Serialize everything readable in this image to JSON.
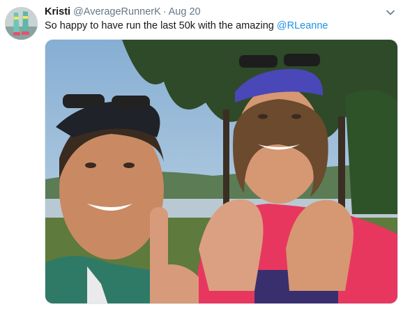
{
  "tweet": {
    "display_name": "Kristi",
    "handle": "@AverageRunnerK",
    "separator": "·",
    "date": "Aug 20",
    "text_before": "So happy to have run the last 50k with the amazing ",
    "mention": "@RLeanne"
  },
  "colors": {
    "link": "#1b95e0",
    "secondary_text": "#657786",
    "primary_text": "#14171a"
  },
  "icons": {
    "menu": "chevron-down-icon"
  }
}
